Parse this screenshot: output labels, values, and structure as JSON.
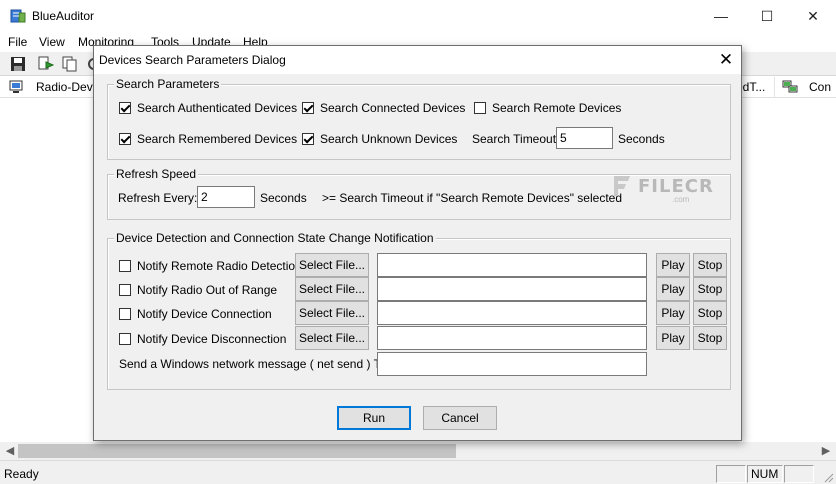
{
  "window": {
    "title": "BlueAuditor",
    "min": "—",
    "max": "☐",
    "close": "✕"
  },
  "menu": [
    "File",
    "View",
    "Monitoring",
    "Tools",
    "Update",
    "Help"
  ],
  "toolbar": {
    "icons": [
      "save-icon",
      "scan-icon",
      "copy-icon",
      "toolbar-extra-icon"
    ]
  },
  "list": {
    "headers": {
      "first": "Radio-Devi",
      "right1": "edT...",
      "right2": "Con"
    }
  },
  "status": {
    "text": "Ready",
    "num": "NUM"
  },
  "dialog": {
    "title": "Devices Search Parameters Dialog",
    "close": "✕",
    "search_params": {
      "label": "Search Parameters",
      "authenticated": {
        "label": "Search Authenticated Devices",
        "checked": true
      },
      "connected": {
        "label": "Search Connected Devices",
        "checked": true
      },
      "remote": {
        "label": "Search Remote Devices",
        "checked": false
      },
      "remembered": {
        "label": "Search Remembered Devices",
        "checked": true
      },
      "unknown": {
        "label": "Search Unknown Devices",
        "checked": true
      },
      "timeout_label": "Search Timeout:",
      "timeout_value": "5",
      "timeout_unit": "Seconds"
    },
    "refresh": {
      "label": "Refresh Speed",
      "every_label": "Refresh Every:",
      "every_value": "2",
      "unit": "Seconds",
      "note": ">= Search Timeout if \"Search Remote Devices\" selected"
    },
    "notify": {
      "label": "Device Detection and Connection State Change Notification",
      "rows": [
        {
          "label": "Notify Remote Radio Detection",
          "checked": false,
          "select": "Select File...",
          "path": "",
          "play": "Play",
          "stop": "Stop"
        },
        {
          "label": "Notify Radio Out of Range",
          "checked": false,
          "select": "Select File...",
          "path": "",
          "play": "Play",
          "stop": "Stop"
        },
        {
          "label": "Notify Device Connection",
          "checked": false,
          "select": "Select File...",
          "path": "",
          "play": "Play",
          "stop": "Stop"
        },
        {
          "label": "Notify Device Disconnection",
          "checked": false,
          "select": "Select File...",
          "path": "",
          "play": "Play",
          "stop": "Stop"
        }
      ],
      "netsend_label": "Send a Windows network message ( net send )  To:",
      "netsend_value": ""
    },
    "run": "Run",
    "cancel": "Cancel"
  },
  "watermark": {
    "text": "FILECR",
    "sub": ".com"
  }
}
